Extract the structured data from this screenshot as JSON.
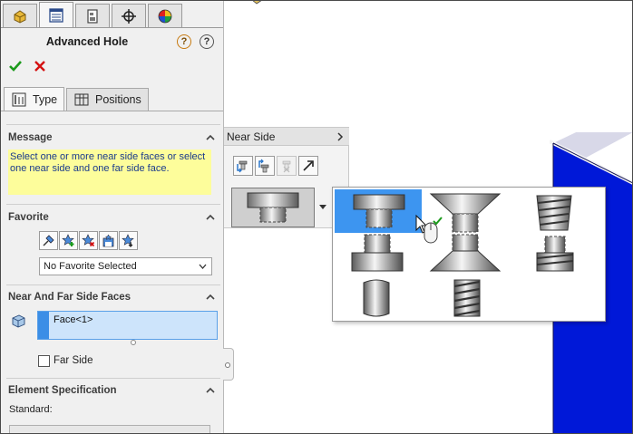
{
  "property_manager": {
    "tabs": [
      {
        "icon": "feature-manager-icon",
        "active": false
      },
      {
        "icon": "property-manager-icon",
        "active": true
      },
      {
        "icon": "configuration-manager-icon",
        "active": false
      },
      {
        "icon": "dimxpert-manager-icon",
        "active": false
      },
      {
        "icon": "display-manager-icon",
        "active": false
      }
    ],
    "title": "Advanced Hole",
    "subtabs": {
      "type_label": "Type",
      "positions_label": "Positions"
    },
    "message": {
      "section_title": "Message",
      "text": "Select one or more near side faces or select one near side and one far side face."
    },
    "favorite": {
      "section_title": "Favorite",
      "buttons": [
        "apply-defaults-icon",
        "add-favorite-icon",
        "delete-favorite-icon",
        "save-favorite-icon",
        "load-favorite-icon"
      ],
      "selected": "No Favorite Selected"
    },
    "faces": {
      "section_title": "Near And Far Side Faces",
      "items": [
        "Face<1>"
      ],
      "far_side_label": "Far Side",
      "far_side_checked": false
    },
    "element_spec": {
      "section_title": "Element Specification",
      "standard_label": "Standard:"
    }
  },
  "near_side_flyout": {
    "title": "Near Side",
    "tools": [
      "insert-element-below-icon",
      "insert-element-above-icon",
      "delete-element-icon",
      "go-to-far-side-icon"
    ],
    "current_type": "counterbore"
  },
  "hole_type_menu": {
    "options": [
      "counterbore",
      "countersink",
      "tapered-tap",
      "counterbore-bottom",
      "countersink-bottom",
      "tapped-straight",
      "straight",
      "straight-tap"
    ],
    "selected": "counterbore"
  },
  "colors": {
    "message_bg": "#fdfd9b",
    "message_text": "#1a3a8c",
    "selection_blue": "#3d95f0",
    "face_list_bg": "#cde4fb",
    "part_blue": "#0018d8",
    "ok_green": "#1b9a1b",
    "cancel_red": "#d41010"
  }
}
